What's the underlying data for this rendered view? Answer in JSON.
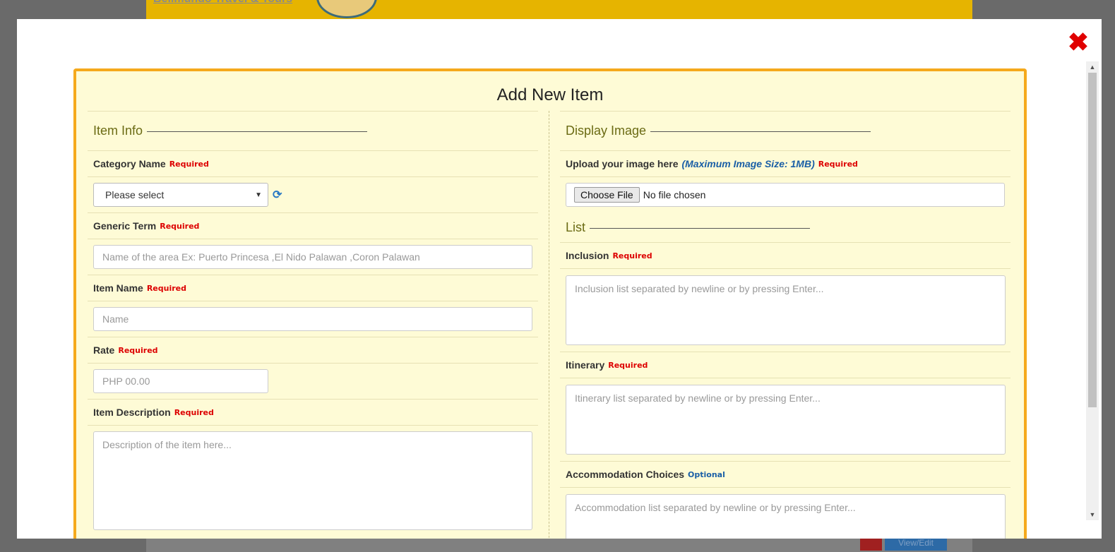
{
  "background": {
    "header_link": "Bellmundo Travel & Tours",
    "view_edit_label": "View/Edit"
  },
  "form": {
    "title": "Add New Item",
    "item_info": {
      "heading": "Item Info",
      "category": {
        "label": "Category Name",
        "required": "Required",
        "selected": "Please select"
      },
      "generic_term": {
        "label": "Generic Term",
        "required": "Required",
        "placeholder": "Name of the area Ex: Puerto Princesa ,El Nido Palawan ,Coron Palawan"
      },
      "item_name": {
        "label": "Item Name",
        "required": "Required",
        "placeholder": "Name"
      },
      "rate": {
        "label": "Rate",
        "required": "Required",
        "placeholder": "PHP 00.00"
      },
      "description": {
        "label": "Item Description",
        "required": "Required",
        "placeholder": "Description of the item here..."
      }
    },
    "display_image": {
      "heading": "Display Image",
      "upload": {
        "label": "Upload your image here",
        "hint": "(Maximum Image Size: 1MB)",
        "required": "Required",
        "button": "Choose File",
        "status": "No file chosen"
      }
    },
    "list": {
      "heading": "List",
      "inclusion": {
        "label": "Inclusion",
        "required": "Required",
        "placeholder": "Inclusion list separated by newline or by pressing Enter..."
      },
      "itinerary": {
        "label": "Itinerary",
        "required": "Required",
        "placeholder": "Itinerary list separated by newline or by pressing Enter..."
      },
      "accommodation": {
        "label": "Accommodation Choices",
        "optional": "Optional",
        "placeholder": "Accommodation list separated by newline or by pressing Enter..."
      }
    }
  },
  "colors": {
    "panel_bg": "#fefbd6",
    "panel_border": "#f5a91c",
    "required": "#dd0000",
    "optional": "#1a5fa6",
    "close": "#e00000"
  },
  "icons": {
    "close": "close-x-icon",
    "refresh": "refresh-icon",
    "caret": "chevron-down-icon"
  }
}
